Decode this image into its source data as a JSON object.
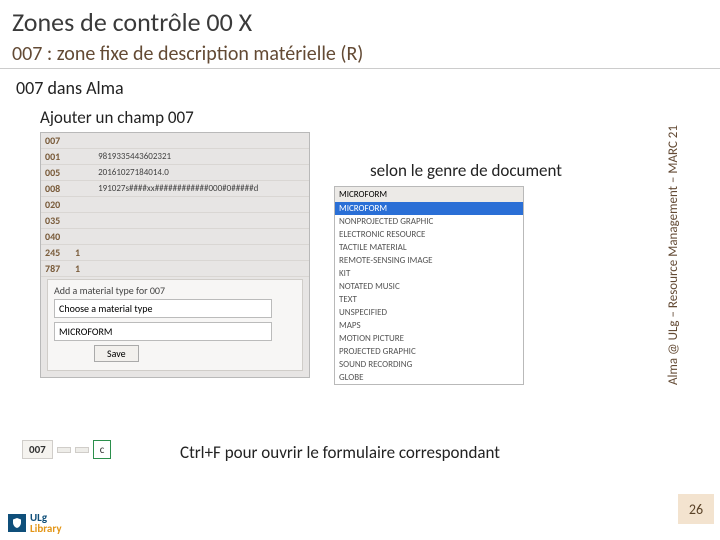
{
  "title": "Zones de contrôle 00 X",
  "subtitle": "007 : zone fixe de description matérielle (R)",
  "section": "007 dans Alma",
  "sub2": "Ajouter un champ 007",
  "caption2": "selon le genre de document",
  "instruction": "Ctrl+F pour ouvrir le formulaire correspondant",
  "vert": "Alma @ ULg – Resource Management – MARC 21",
  "pagenum": "26",
  "logo": {
    "line1": "ULg",
    "line2": "Library"
  },
  "rows": [
    {
      "tag": "007",
      "i1": "",
      "i2": "",
      "val": ""
    },
    {
      "tag": "001",
      "i1": "",
      "i2": "",
      "val": "9819335443602321"
    },
    {
      "tag": "005",
      "i1": "",
      "i2": "",
      "val": "20161027184014.0"
    },
    {
      "tag": "008",
      "i1": "",
      "i2": "",
      "val": "191027s####xx############000#0#####d"
    },
    {
      "tag": "020",
      "i1": "",
      "i2": "",
      "val": ""
    },
    {
      "tag": "035",
      "i1": "",
      "i2": "",
      "val": ""
    },
    {
      "tag": "040",
      "i1": "",
      "i2": "",
      "val": ""
    },
    {
      "tag": "245",
      "i1": "1",
      "i2": "",
      "val": ""
    },
    {
      "tag": "787",
      "i1": "1",
      "i2": "",
      "val": ""
    }
  ],
  "panel": {
    "lbl": "Add a material type for 007",
    "placeholder": "Choose a material type",
    "selected": "MICROFORM",
    "save": "Save"
  },
  "dd": {
    "head": "MICROFORM",
    "items": [
      "MICROFORM",
      "NONPROJECTED GRAPHIC",
      "ELECTRONIC RESOURCE",
      "TACTILE MATERIAL",
      "REMOTE-SENSING IMAGE",
      "KIT",
      "NOTATED MUSIC",
      "TEXT",
      "UNSPECIFIED",
      "MAPS",
      "MOTION PICTURE",
      "PROJECTED GRAPHIC",
      "SOUND RECORDING",
      "GLOBE"
    ]
  },
  "row007": {
    "tag": "007",
    "blank": " ",
    "val": "c"
  }
}
